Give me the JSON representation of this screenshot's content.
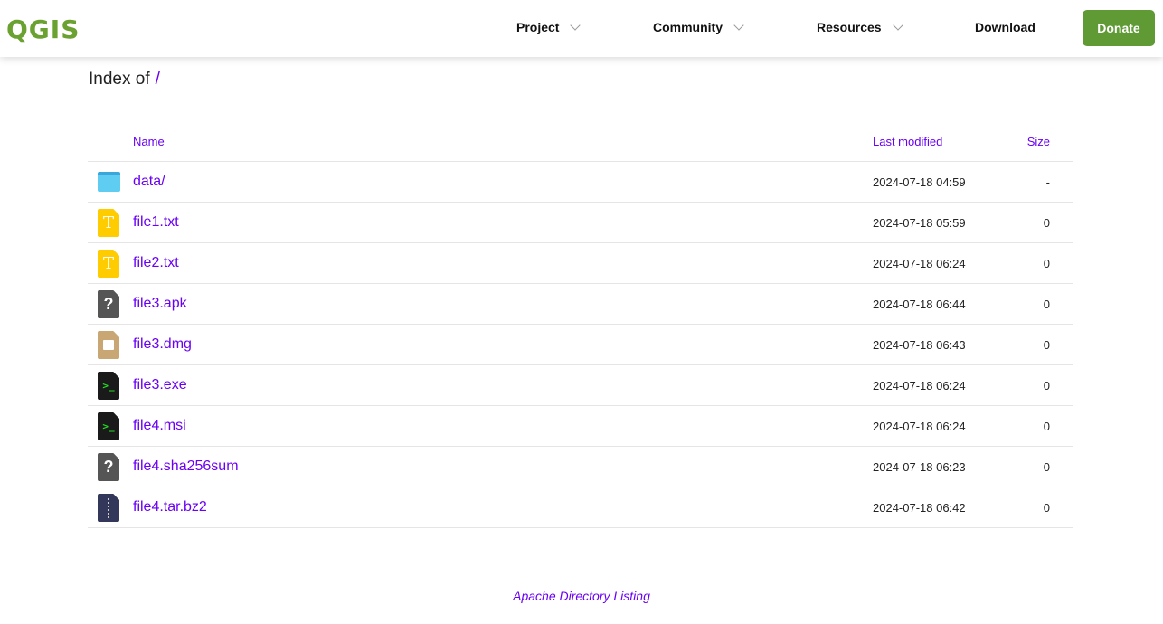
{
  "nav": {
    "logo": "QGIS",
    "items": [
      {
        "label": "Project",
        "dropdown": true
      },
      {
        "label": "Community",
        "dropdown": true
      },
      {
        "label": "Resources",
        "dropdown": true
      },
      {
        "label": "Download",
        "dropdown": false
      }
    ],
    "donate": "Donate"
  },
  "heading": {
    "prefix": "Index of",
    "path": "/"
  },
  "columns": {
    "name": "Name",
    "modified": "Last modified",
    "size": "Size"
  },
  "rows": [
    {
      "name": "data/",
      "modified": "2024-07-18 04:59",
      "size": "-",
      "icon": "folder"
    },
    {
      "name": "file1.txt",
      "modified": "2024-07-18 05:59",
      "size": "0",
      "icon": "text"
    },
    {
      "name": "file2.txt",
      "modified": "2024-07-18 06:24",
      "size": "0",
      "icon": "text"
    },
    {
      "name": "file3.apk",
      "modified": "2024-07-18 06:44",
      "size": "0",
      "icon": "unknown"
    },
    {
      "name": "file3.dmg",
      "modified": "2024-07-18 06:43",
      "size": "0",
      "icon": "package"
    },
    {
      "name": "file3.exe",
      "modified": "2024-07-18 06:24",
      "size": "0",
      "icon": "exec"
    },
    {
      "name": "file4.msi",
      "modified": "2024-07-18 06:24",
      "size": "0",
      "icon": "exec"
    },
    {
      "name": "file4.sha256sum",
      "modified": "2024-07-18 06:23",
      "size": "0",
      "icon": "unknown"
    },
    {
      "name": "file4.tar.bz2",
      "modified": "2024-07-18 06:42",
      "size": "0",
      "icon": "archive"
    }
  ],
  "footer": "Apache Directory Listing",
  "colors": {
    "brand": "#6aa131",
    "link": "#6a00f4",
    "donate": "#5f9a35"
  }
}
